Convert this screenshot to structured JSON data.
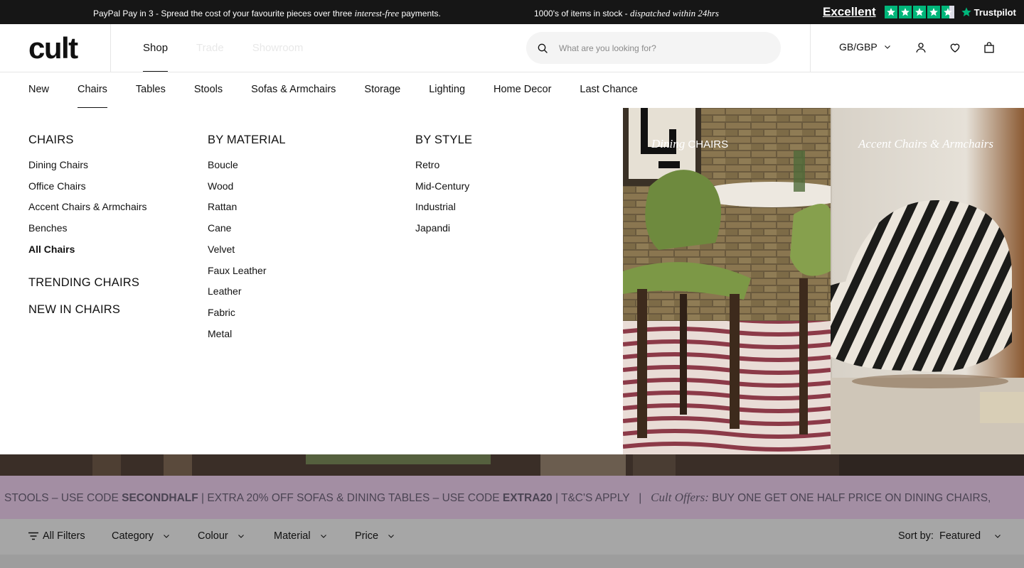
{
  "announcement": {
    "paypal_prefix": "PayPal Pay in 3 - Spread the cost of your favourite pieces over three ",
    "paypal_emph": "interest-free",
    "paypal_suffix": " payments.",
    "stock_prefix": "1000's of items in stock - ",
    "stock_emph": "dispatched within 24hrs",
    "rating_word": "Excellent",
    "rating_stars": 4.5,
    "trustpilot_label": "Trustpilot"
  },
  "header": {
    "logo": "cult",
    "nav": [
      {
        "label": "Shop"
      },
      {
        "label": "Trade"
      },
      {
        "label": "Showroom"
      }
    ],
    "search_placeholder": "What are you looking for?",
    "currency": "GB/GBP"
  },
  "category_nav": [
    {
      "label": "New"
    },
    {
      "label": "Chairs"
    },
    {
      "label": "Tables"
    },
    {
      "label": "Stools"
    },
    {
      "label": "Sofas & Armchairs"
    },
    {
      "label": "Storage"
    },
    {
      "label": "Lighting"
    },
    {
      "label": "Home Decor"
    },
    {
      "label": "Last Chance"
    }
  ],
  "mega_menu": {
    "chairs": {
      "heading": "CHAIRS",
      "links": [
        "Dining Chairs",
        "Office Chairs",
        "Accent Chairs & Armchairs",
        "Benches",
        "All Chairs"
      ],
      "trending": "TRENDING CHAIRS",
      "new_in": "NEW IN CHAIRS"
    },
    "material": {
      "heading": "BY MATERIAL",
      "links": [
        "Boucle",
        "Wood",
        "Rattan",
        "Cane",
        "Velvet",
        "Faux Leather",
        "Leather",
        "Fabric",
        "Metal"
      ]
    },
    "style": {
      "heading": "BY STYLE",
      "links": [
        "Retro",
        "Mid-Century",
        "Industrial",
        "Japandi"
      ]
    },
    "promos": [
      {
        "emph": "Dining",
        "label": " CHAIRS"
      },
      {
        "emph": "Accent Chairs & Armchairs",
        "label": ""
      }
    ]
  },
  "ticker": {
    "part1": "STOOLS – USE CODE ",
    "code1": "SECONDHALF",
    "part2": " | EXTRA 20% OFF SOFAS & DINING TABLES – USE CODE ",
    "code2": "EXTRA20",
    "part3": " | T&C'S APPLY   |   ",
    "offers_emph": "Cult Offers:",
    "part4": " BUY ONE GET ONE HALF PRICE ON DINING CHAIRS,"
  },
  "filters": {
    "all_filters": "All Filters",
    "category": "Category",
    "colour": "Colour",
    "material": "Material",
    "price": "Price",
    "sort_by_label": "Sort by:",
    "sort_value": "Featured"
  }
}
